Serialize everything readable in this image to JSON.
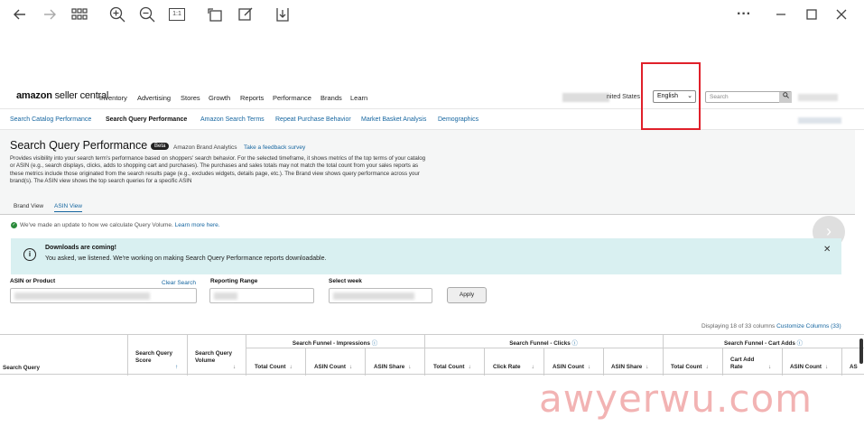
{
  "viewer": {
    "icons": [
      "back-arrow-icon",
      "forward-arrow-icon",
      "grid-icon",
      "zoom-in-icon",
      "zoom-out-icon",
      "actual-size-icon",
      "rotate-icon",
      "edit-icon",
      "download-icon",
      "more-icon",
      "minimize-icon",
      "maximize-icon",
      "close-icon"
    ],
    "actual_size_label": "1:1"
  },
  "logo": {
    "bold": "amazon",
    "sub": " seller central"
  },
  "nav": [
    "Inventory",
    "Advertising",
    "Stores",
    "Growth",
    "Reports",
    "Performance",
    "Brands",
    "Learn"
  ],
  "country_text": "nited States",
  "language": "English",
  "search_placeholder": "Search",
  "subnav": [
    "Search Catalog Performance",
    "Search Query Performance",
    "Amazon Search Terms",
    "Repeat Purchase Behavior",
    "Market Basket Analysis",
    "Demographics"
  ],
  "page": {
    "title": "Search Query Performance",
    "badge": "Beta",
    "brand_analytics": "Amazon Brand Analytics",
    "feedback": "Take a feedback survey",
    "description": "Provides visibility into your search term's performance based on shoppers' search behavior. For the selected timeframe, it shows metrics of the top terms of your catalog or ASIN (e.g., search displays, clicks, adds to shopping cart and purchases). The purchases and sales totals may not match the total count from your sales reports as these metrics include those originated from the search results page (e.g., excludes widgets, details page, etc.). The Brand view shows query performance across your brand(s). The ASIN view shows the top search queries for a specific ASIN",
    "view_tabs": [
      "Brand View",
      "ASIN View"
    ],
    "update_text": "We've made an update to how we calculate Query Volume.",
    "learn_more": "Learn more here."
  },
  "alert": {
    "title": "Downloads are coming!",
    "body": "You asked, we listened. We're working on making Search Query Performance reports downloadable."
  },
  "filters": {
    "asin_label": "ASIN or Product",
    "clear": "Clear Search",
    "range_label": "Reporting Range",
    "week_label": "Select week",
    "apply": "Apply"
  },
  "columns_info": {
    "text": "Displaying 18 of 33 columns",
    "link": "Customize Columns (33)"
  },
  "table": {
    "search_query": "Search Query",
    "score": "Search Query Score",
    "volume": "Search Query Volume",
    "groups": [
      "Search Funnel - Impressions",
      "Search Funnel - Clicks",
      "Search Funnel - Cart Adds"
    ],
    "impressions_cols": [
      "Total Count",
      "ASIN Count",
      "ASIN Share"
    ],
    "clicks_cols": [
      "Total Count",
      "Click Rate",
      "ASIN Count",
      "ASIN Share"
    ],
    "cart_cols": [
      "Total Count",
      "Cart Add Rate",
      "ASIN Count",
      "AS"
    ]
  },
  "watermark": "awyerwu.com"
}
